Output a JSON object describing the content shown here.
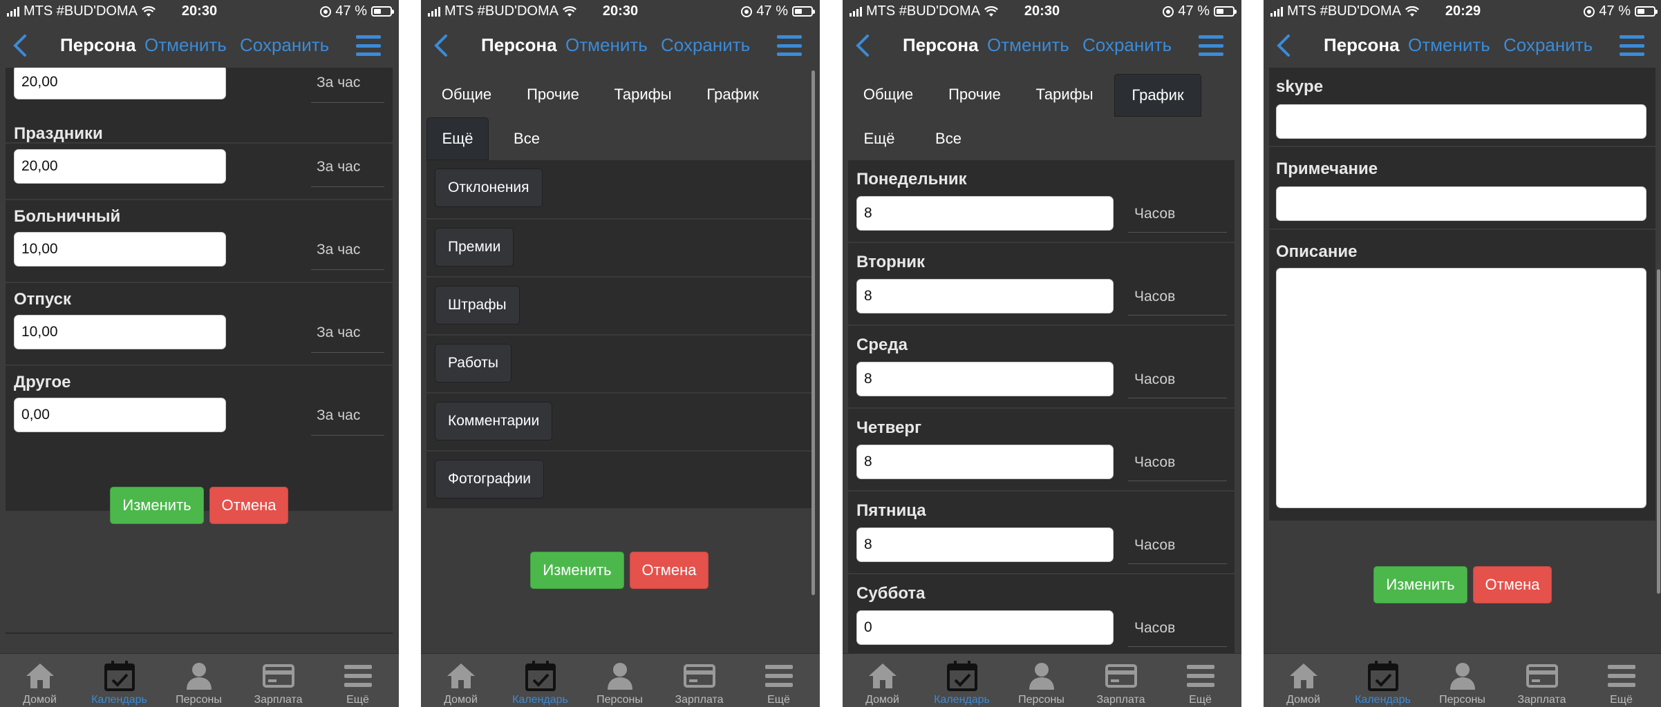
{
  "colors": {
    "accent": "#3b8bd8",
    "background": "#3c3c3c",
    "panel": "#2c2c2c",
    "btn_green": "#4cb84c",
    "btn_red": "#e5514b"
  },
  "status": {
    "carrier": "MTS #BUD'DOMA",
    "battery": "47 %",
    "battery_level": 0.47
  },
  "nav": {
    "title": "Персона",
    "cancel": "Отменить",
    "save": "Сохранить"
  },
  "actions": {
    "change": "Изменить",
    "cancel": "Отмена"
  },
  "tabbar": [
    {
      "label": "Домой",
      "icon": "home-icon"
    },
    {
      "label": "Календарь",
      "icon": "calendar-icon"
    },
    {
      "label": "Персоны",
      "icon": "person-icon"
    },
    {
      "label": "Зарплата",
      "icon": "card-icon"
    },
    {
      "label": "Ещё",
      "icon": "menu-icon"
    }
  ],
  "screen1": {
    "time": "20:30",
    "fields": [
      {
        "label": "",
        "value": "20,00",
        "unit": "За час"
      },
      {
        "label": "Праздники",
        "value": "20,00",
        "unit": "За час"
      },
      {
        "label": "Больничный",
        "value": "10,00",
        "unit": "За час"
      },
      {
        "label": "Отпуск",
        "value": "10,00",
        "unit": "За час"
      },
      {
        "label": "Другое",
        "value": "0,00",
        "unit": "За час"
      }
    ]
  },
  "screen2": {
    "time": "20:30",
    "tabs": [
      "Общие",
      "Прочие",
      "Тарифы",
      "График",
      "Ещё",
      "Все"
    ],
    "items": [
      "Отклонения",
      "Премии",
      "Штрафы",
      "Работы",
      "Комментарии",
      "Фотографии"
    ]
  },
  "screen3": {
    "time": "20:30",
    "tabs": [
      "Общие",
      "Прочие",
      "Тарифы",
      "График",
      "Ещё",
      "Все"
    ],
    "fields": [
      {
        "label": "Понедельник",
        "value": "8",
        "unit": "Часов"
      },
      {
        "label": "Вторник",
        "value": "8",
        "unit": "Часов"
      },
      {
        "label": "Среда",
        "value": "8",
        "unit": "Часов"
      },
      {
        "label": "Четверг",
        "value": "8",
        "unit": "Часов"
      },
      {
        "label": "Пятница",
        "value": "8",
        "unit": "Часов"
      },
      {
        "label": "Суббота",
        "value": "0",
        "unit": "Часов"
      }
    ]
  },
  "screen4": {
    "time": "20:29",
    "fields": [
      {
        "label": "skype",
        "value": ""
      },
      {
        "label": "Примечание",
        "value": ""
      },
      {
        "label": "Описание",
        "value": ""
      }
    ]
  }
}
